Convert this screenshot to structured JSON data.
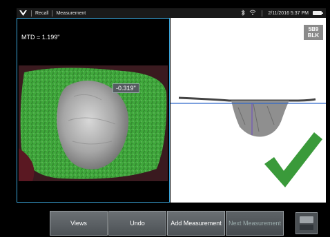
{
  "status_bar": {
    "logo_icon": "v-logo-icon",
    "recall_label": "Recall",
    "measurement_label": "Measurement",
    "datetime": "2/11/2016 5:37 PM",
    "icons": [
      "bluetooth-icon",
      "wifi-icon",
      "battery-icon"
    ]
  },
  "left_view": {
    "mtd_readout": "MTD = 1.199\"",
    "depth_tag": "-0.319\""
  },
  "right_view": {
    "badge_line1": "5B9",
    "badge_line2": "BLK",
    "status_icon": "green-checkmark-icon",
    "accent_color": "#3ba7dc",
    "check_color": "#3a9a3a"
  },
  "toolbar": {
    "views_label": "Views",
    "undo_label": "Undo",
    "add_measurement_label": "Add Measurement",
    "next_measurement_label": "Next Measurement"
  }
}
